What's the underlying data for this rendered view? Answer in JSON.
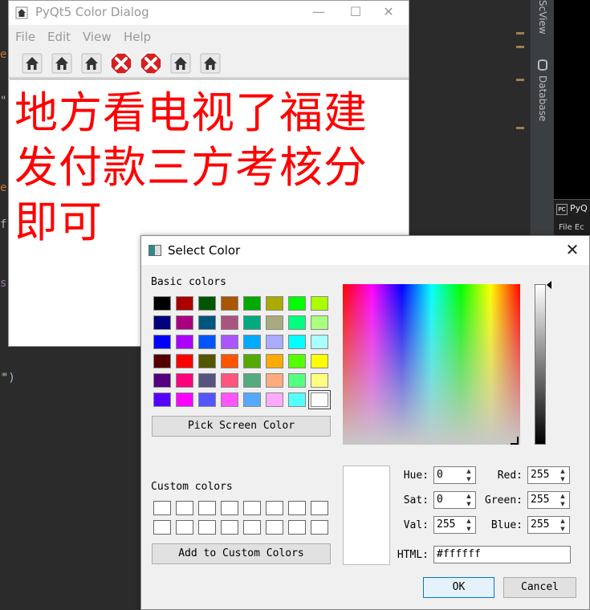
{
  "ide": {
    "tabs": {
      "scview": "ScView",
      "database": "Database"
    },
    "thumb": {
      "logo": "PC",
      "title": "PyQ",
      "menu": "File Ec"
    },
    "colors": {
      "background": "#2b2b2b",
      "panel": "#3c3f41"
    }
  },
  "main_window": {
    "title": "PyQt5 Color Dialog",
    "menu": {
      "file": "File",
      "edit": "Edit",
      "view": "View",
      "help": "Help"
    },
    "toolbar_icons": [
      "home-icon",
      "home-icon",
      "home-icon",
      "error-icon",
      "error-icon",
      "home-icon",
      "home-icon"
    ],
    "content_text": "地方看电视了福建发付款三方考核分即可",
    "text_color": "#ff0000"
  },
  "color_dialog": {
    "title": "Select Color",
    "basic_colors_label": "Basic colors",
    "basic_colors": [
      [
        "#000000",
        "#aa0000",
        "#005500",
        "#aa5500",
        "#00aa00",
        "#aaaa00",
        "#00ff00",
        "#aaff00"
      ],
      [
        "#00007f",
        "#aa007f",
        "#00557f",
        "#aa557f",
        "#00aa7f",
        "#aaaa7f",
        "#00ff7f",
        "#aaff7f"
      ],
      [
        "#0000ff",
        "#aa00ff",
        "#0055ff",
        "#aa55ff",
        "#00aaff",
        "#aaaaff",
        "#00ffff",
        "#aaffff"
      ],
      [
        "#550000",
        "#ff0000",
        "#555500",
        "#ff5500",
        "#55aa00",
        "#ffaa00",
        "#55ff00",
        "#ffff00"
      ],
      [
        "#55007f",
        "#ff007f",
        "#55557f",
        "#ff557f",
        "#55aa7f",
        "#ffaa7f",
        "#55ff7f",
        "#ffff7f"
      ],
      [
        "#5500ff",
        "#ff00ff",
        "#5555ff",
        "#ff55ff",
        "#55aaff",
        "#ffaaff",
        "#55ffff",
        "#ffffff"
      ]
    ],
    "selected_swatch": "#ffffff",
    "pick_screen_label": "Pick Screen Color",
    "custom_colors_label": "Custom colors",
    "add_custom_label": "Add to Custom Colors",
    "fields": {
      "hue": {
        "label": "Hue:",
        "value": "0"
      },
      "sat": {
        "label": "Sat:",
        "value": "0"
      },
      "val": {
        "label": "Val:",
        "value": "255"
      },
      "red": {
        "label": "Red:",
        "value": "255"
      },
      "green": {
        "label": "Green:",
        "value": "255"
      },
      "blue": {
        "label": "Blue:",
        "value": "255"
      },
      "html": {
        "label": "HTML:",
        "value": "#ffffff"
      }
    },
    "ok_label": "OK",
    "cancel_label": "Cancel",
    "current_color": "#ffffff",
    "value_level": 1.0
  }
}
